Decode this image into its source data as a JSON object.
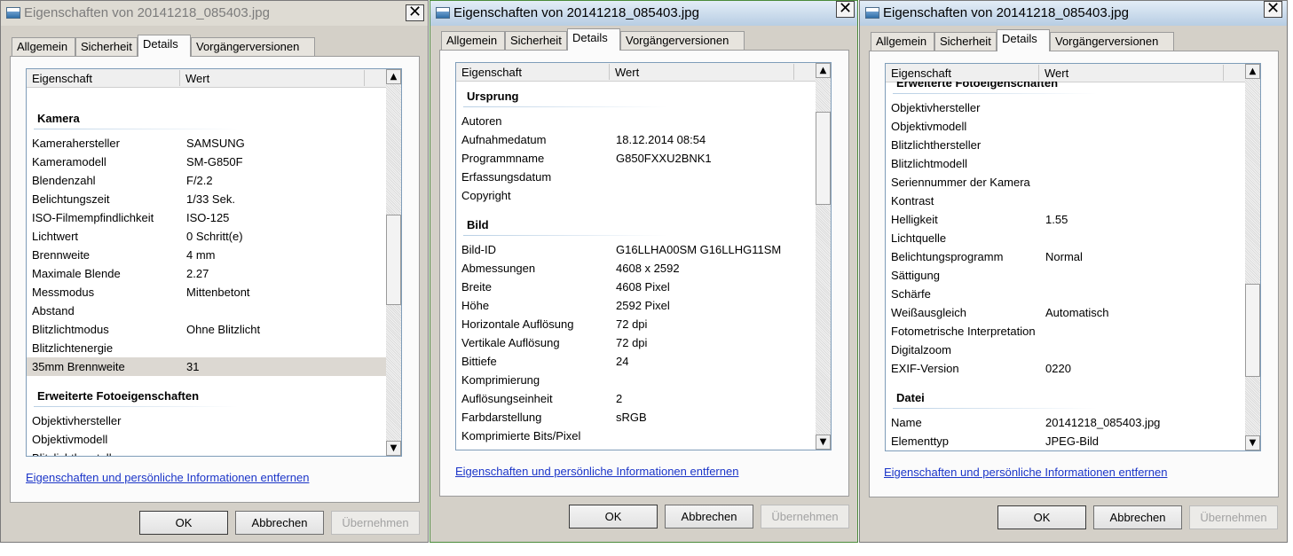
{
  "window_title": "Eigenschaften von 20141218_085403.jpg",
  "close_glyph": "✕",
  "tabs": [
    "Allgemein",
    "Sicherheit",
    "Details",
    "Vorgängerversionen"
  ],
  "columns": {
    "property": "Eigenschaft",
    "value": "Wert"
  },
  "scroll_up": "▲",
  "scroll_down": "▼",
  "remove_link": "Eigenschaften und persönliche Informationen entfernen",
  "buttons": {
    "ok": "OK",
    "cancel": "Abbrechen",
    "apply": "Übernehmen"
  },
  "dialog1": {
    "groups": [
      {
        "title": "Kamera",
        "rows": [
          {
            "k": "Kamerahersteller",
            "v": "SAMSUNG"
          },
          {
            "k": "Kameramodell",
            "v": "SM-G850F"
          },
          {
            "k": "Blendenzahl",
            "v": "F/2.2"
          },
          {
            "k": "Belichtungszeit",
            "v": "1/33 Sek."
          },
          {
            "k": "ISO-Filmempfindlichkeit",
            "v": "ISO-125"
          },
          {
            "k": "Lichtwert",
            "v": "0 Schritt(e)"
          },
          {
            "k": "Brennweite",
            "v": "4 mm"
          },
          {
            "k": "Maximale Blende",
            "v": "2.27"
          },
          {
            "k": "Messmodus",
            "v": "Mittenbetont"
          },
          {
            "k": "Abstand",
            "v": ""
          },
          {
            "k": "Blitzlichtmodus",
            "v": "Ohne Blitzlicht"
          },
          {
            "k": "Blitzlichtenergie",
            "v": ""
          },
          {
            "k": "35mm Brennweite",
            "v": "31"
          }
        ]
      },
      {
        "title": "Erweiterte Fotoeigenschaften",
        "rows": [
          {
            "k": "Objektivhersteller",
            "v": ""
          },
          {
            "k": "Objektivmodell",
            "v": ""
          },
          {
            "k": "Blitzlichthersteller",
            "v": ""
          }
        ]
      }
    ]
  },
  "dialog2": {
    "groups": [
      {
        "title": "Ursprung",
        "rows": [
          {
            "k": "Autoren",
            "v": ""
          },
          {
            "k": "Aufnahmedatum",
            "v": "18.12.2014 08:54"
          },
          {
            "k": "Programmname",
            "v": "G850FXXU2BNK1"
          },
          {
            "k": "Erfassungsdatum",
            "v": ""
          },
          {
            "k": "Copyright",
            "v": ""
          }
        ]
      },
      {
        "title": "Bild",
        "rows": [
          {
            "k": "Bild-ID",
            "v": "G16LLHA00SM G16LLHG11SM"
          },
          {
            "k": "Abmessungen",
            "v": "4608 x 2592"
          },
          {
            "k": "Breite",
            "v": "4608 Pixel"
          },
          {
            "k": "Höhe",
            "v": "2592 Pixel"
          },
          {
            "k": "Horizontale Auflösung",
            "v": "72 dpi"
          },
          {
            "k": "Vertikale Auflösung",
            "v": "72 dpi"
          },
          {
            "k": "Bittiefe",
            "v": "24"
          },
          {
            "k": "Komprimierung",
            "v": ""
          },
          {
            "k": "Auflösungseinheit",
            "v": "2"
          },
          {
            "k": "Farbdarstellung",
            "v": "sRGB"
          },
          {
            "k": "Komprimierte Bits/Pixel",
            "v": ""
          }
        ]
      }
    ]
  },
  "dialog3": {
    "groups": [
      {
        "title": "Erweiterte Fotoeigenschaften",
        "rows": [
          {
            "k": "Objektivhersteller",
            "v": ""
          },
          {
            "k": "Objektivmodell",
            "v": ""
          },
          {
            "k": "Blitzlichthersteller",
            "v": ""
          },
          {
            "k": "Blitzlichtmodell",
            "v": ""
          },
          {
            "k": "Seriennummer der Kamera",
            "v": ""
          },
          {
            "k": "Kontrast",
            "v": ""
          },
          {
            "k": "Helligkeit",
            "v": "1.55"
          },
          {
            "k": "Lichtquelle",
            "v": ""
          },
          {
            "k": "Belichtungsprogramm",
            "v": "Normal"
          },
          {
            "k": "Sättigung",
            "v": ""
          },
          {
            "k": "Schärfe",
            "v": ""
          },
          {
            "k": "Weißausgleich",
            "v": "Automatisch"
          },
          {
            "k": "Fotometrische Interpretation",
            "v": ""
          },
          {
            "k": "Digitalzoom",
            "v": ""
          },
          {
            "k": "EXIF-Version",
            "v": "0220"
          }
        ]
      },
      {
        "title": "Datei",
        "rows": [
          {
            "k": "Name",
            "v": "20141218_085403.jpg"
          },
          {
            "k": "Elementtyp",
            "v": "JPEG-Bild"
          }
        ]
      }
    ]
  }
}
